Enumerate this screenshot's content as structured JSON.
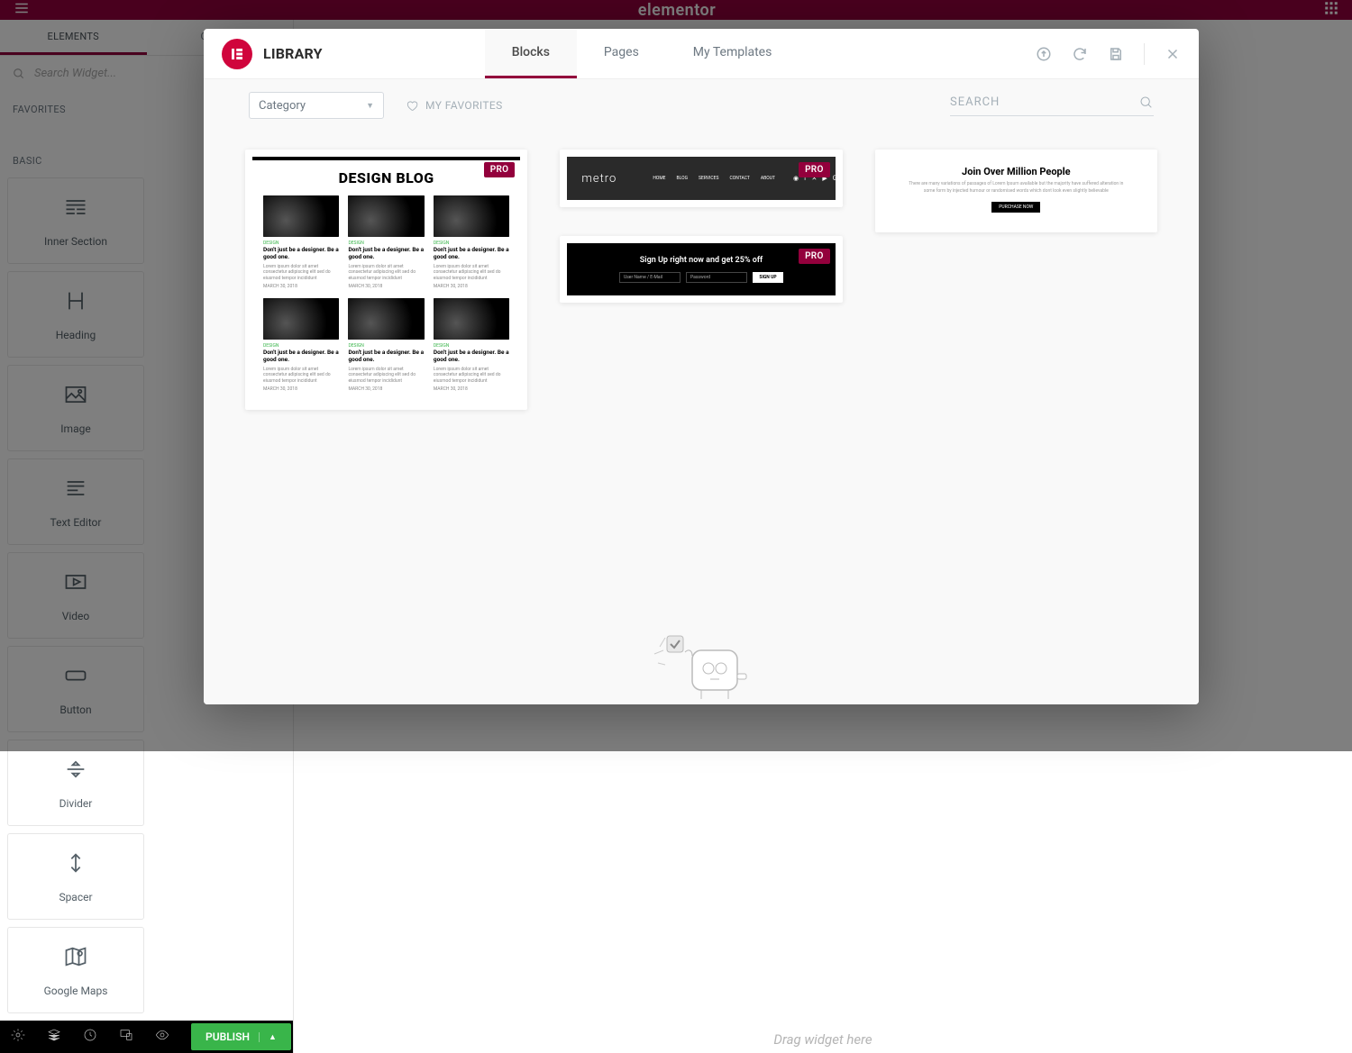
{
  "bg": {
    "brand": "elementor",
    "tabs": {
      "elements": "ELEMENTS",
      "global": "GLOBAL"
    },
    "search_placeholder": "Search Widget...",
    "sections": {
      "favorites": "FAVORITES",
      "basic": "BASIC"
    },
    "widgets": {
      "inner_section": "Inner Section",
      "heading": "Heading",
      "image": "Image",
      "text_editor": "Text Editor",
      "video": "Video",
      "button": "Button",
      "divider": "Divider",
      "spacer": "Spacer",
      "google_maps": "Google Maps"
    },
    "publish": "PUBLISH",
    "drop_hint": "Drag widget here"
  },
  "modal": {
    "title": "LIBRARY",
    "tabs": {
      "blocks": "Blocks",
      "pages": "Pages",
      "my_templates": "My Templates"
    },
    "toolbar": {
      "category_label": "Category",
      "my_favorites": "MY FAVORITES",
      "search_placeholder": "SEARCH"
    },
    "pro_label": "PRO",
    "thumbs": {
      "t1": {
        "heading": "DESIGN BLOG",
        "card_cat": "DESIGN",
        "card_title": "Don't just be a designer. Be a good one.",
        "card_text": "Lorem ipsum dolor sit amet consectetur adipiscing elit sed do eiusmod tempor incididunt",
        "card_date": "MARCH 30, 2018"
      },
      "t2": {
        "heading": "Sign Up right now and get 25% off",
        "placeholder_user": "User Name / E-Mail",
        "placeholder_pass": "Password",
        "button": "SIGN UP"
      },
      "t3": {
        "heading": "Join Over Million People",
        "text": "There are many variations of passages of Lorem Ipsum available but the majority have suffered alteration in some form by injected humour or randomised words which dont look even slightly believable",
        "button": "PURCHASE NOW"
      },
      "t4": {
        "logo": "metro",
        "nav": {
          "home": "HOME",
          "blog": "BLOG",
          "services": "SERVICES",
          "contact": "CONTACT",
          "about": "ABOUT"
        }
      }
    }
  }
}
